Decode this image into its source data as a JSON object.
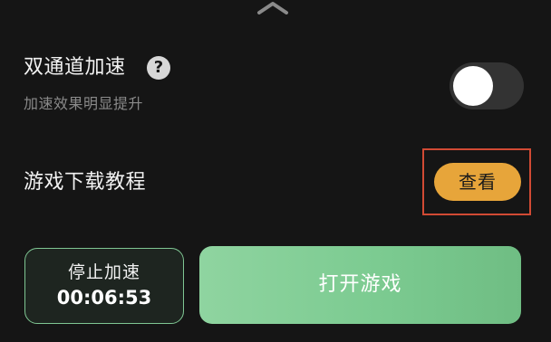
{
  "dual_channel": {
    "title": "双通道加速",
    "subtitle": "加速效果明显提升",
    "help_icon": "?",
    "toggle_state": "off"
  },
  "download_tutorial": {
    "title": "游戏下载教程",
    "view_label": "查看"
  },
  "actions": {
    "stop_label": "停止加速",
    "stop_time": "00:06:53",
    "open_game_label": "打开游戏"
  },
  "colors": {
    "background": "#151515",
    "accent_orange": "#e7a53a",
    "accent_green": "#7ccb91",
    "highlight_red": "#d14a34"
  },
  "icons": {
    "top": "chevron-up-icon",
    "help": "question-circle-icon"
  }
}
